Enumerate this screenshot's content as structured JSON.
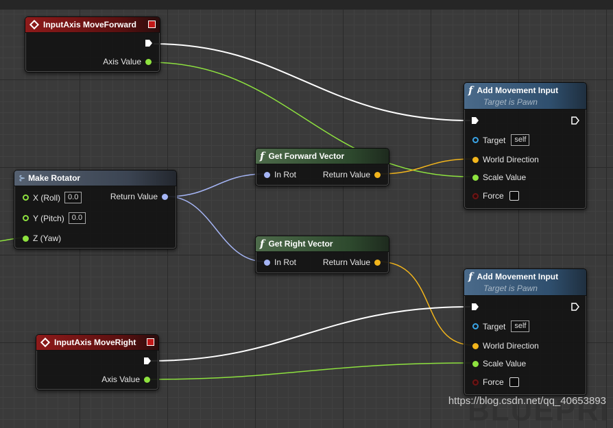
{
  "nodes": {
    "move_forward": {
      "title": "InputAxis MoveForward",
      "axis_value": "Axis Value"
    },
    "move_right": {
      "title": "InputAxis MoveRight",
      "axis_value": "Axis Value"
    },
    "make_rotator": {
      "title": "Make Rotator",
      "x": "X (Roll)",
      "x_val": "0.0",
      "y": "Y (Pitch)",
      "y_val": "0.0",
      "z": "Z (Yaw)",
      "ret": "Return Value"
    },
    "get_forward": {
      "title": "Get Forward Vector",
      "in": "In Rot",
      "ret": "Return Value"
    },
    "get_right": {
      "title": "Get Right Vector",
      "in": "In Rot",
      "ret": "Return Value"
    },
    "add_move_1": {
      "title": "Add Movement Input",
      "subtitle": "Target is Pawn",
      "target": "Target",
      "target_val": "self",
      "world_dir": "World Direction",
      "scale": "Scale Value",
      "force": "Force"
    },
    "add_move_2": {
      "title": "Add Movement Input",
      "subtitle": "Target is Pawn",
      "target": "Target",
      "target_val": "self",
      "world_dir": "World Direction",
      "scale": "Scale Value",
      "force": "Force"
    }
  },
  "watermark": "https://blog.csdn.net/qq_40653893",
  "background_text": "BLUEPRI",
  "colors": {
    "exec": "#ffffff",
    "float": "#8ee23f",
    "vector": "#f2b51c",
    "rotator": "#a5b5f5",
    "object": "#3aa5e8"
  }
}
